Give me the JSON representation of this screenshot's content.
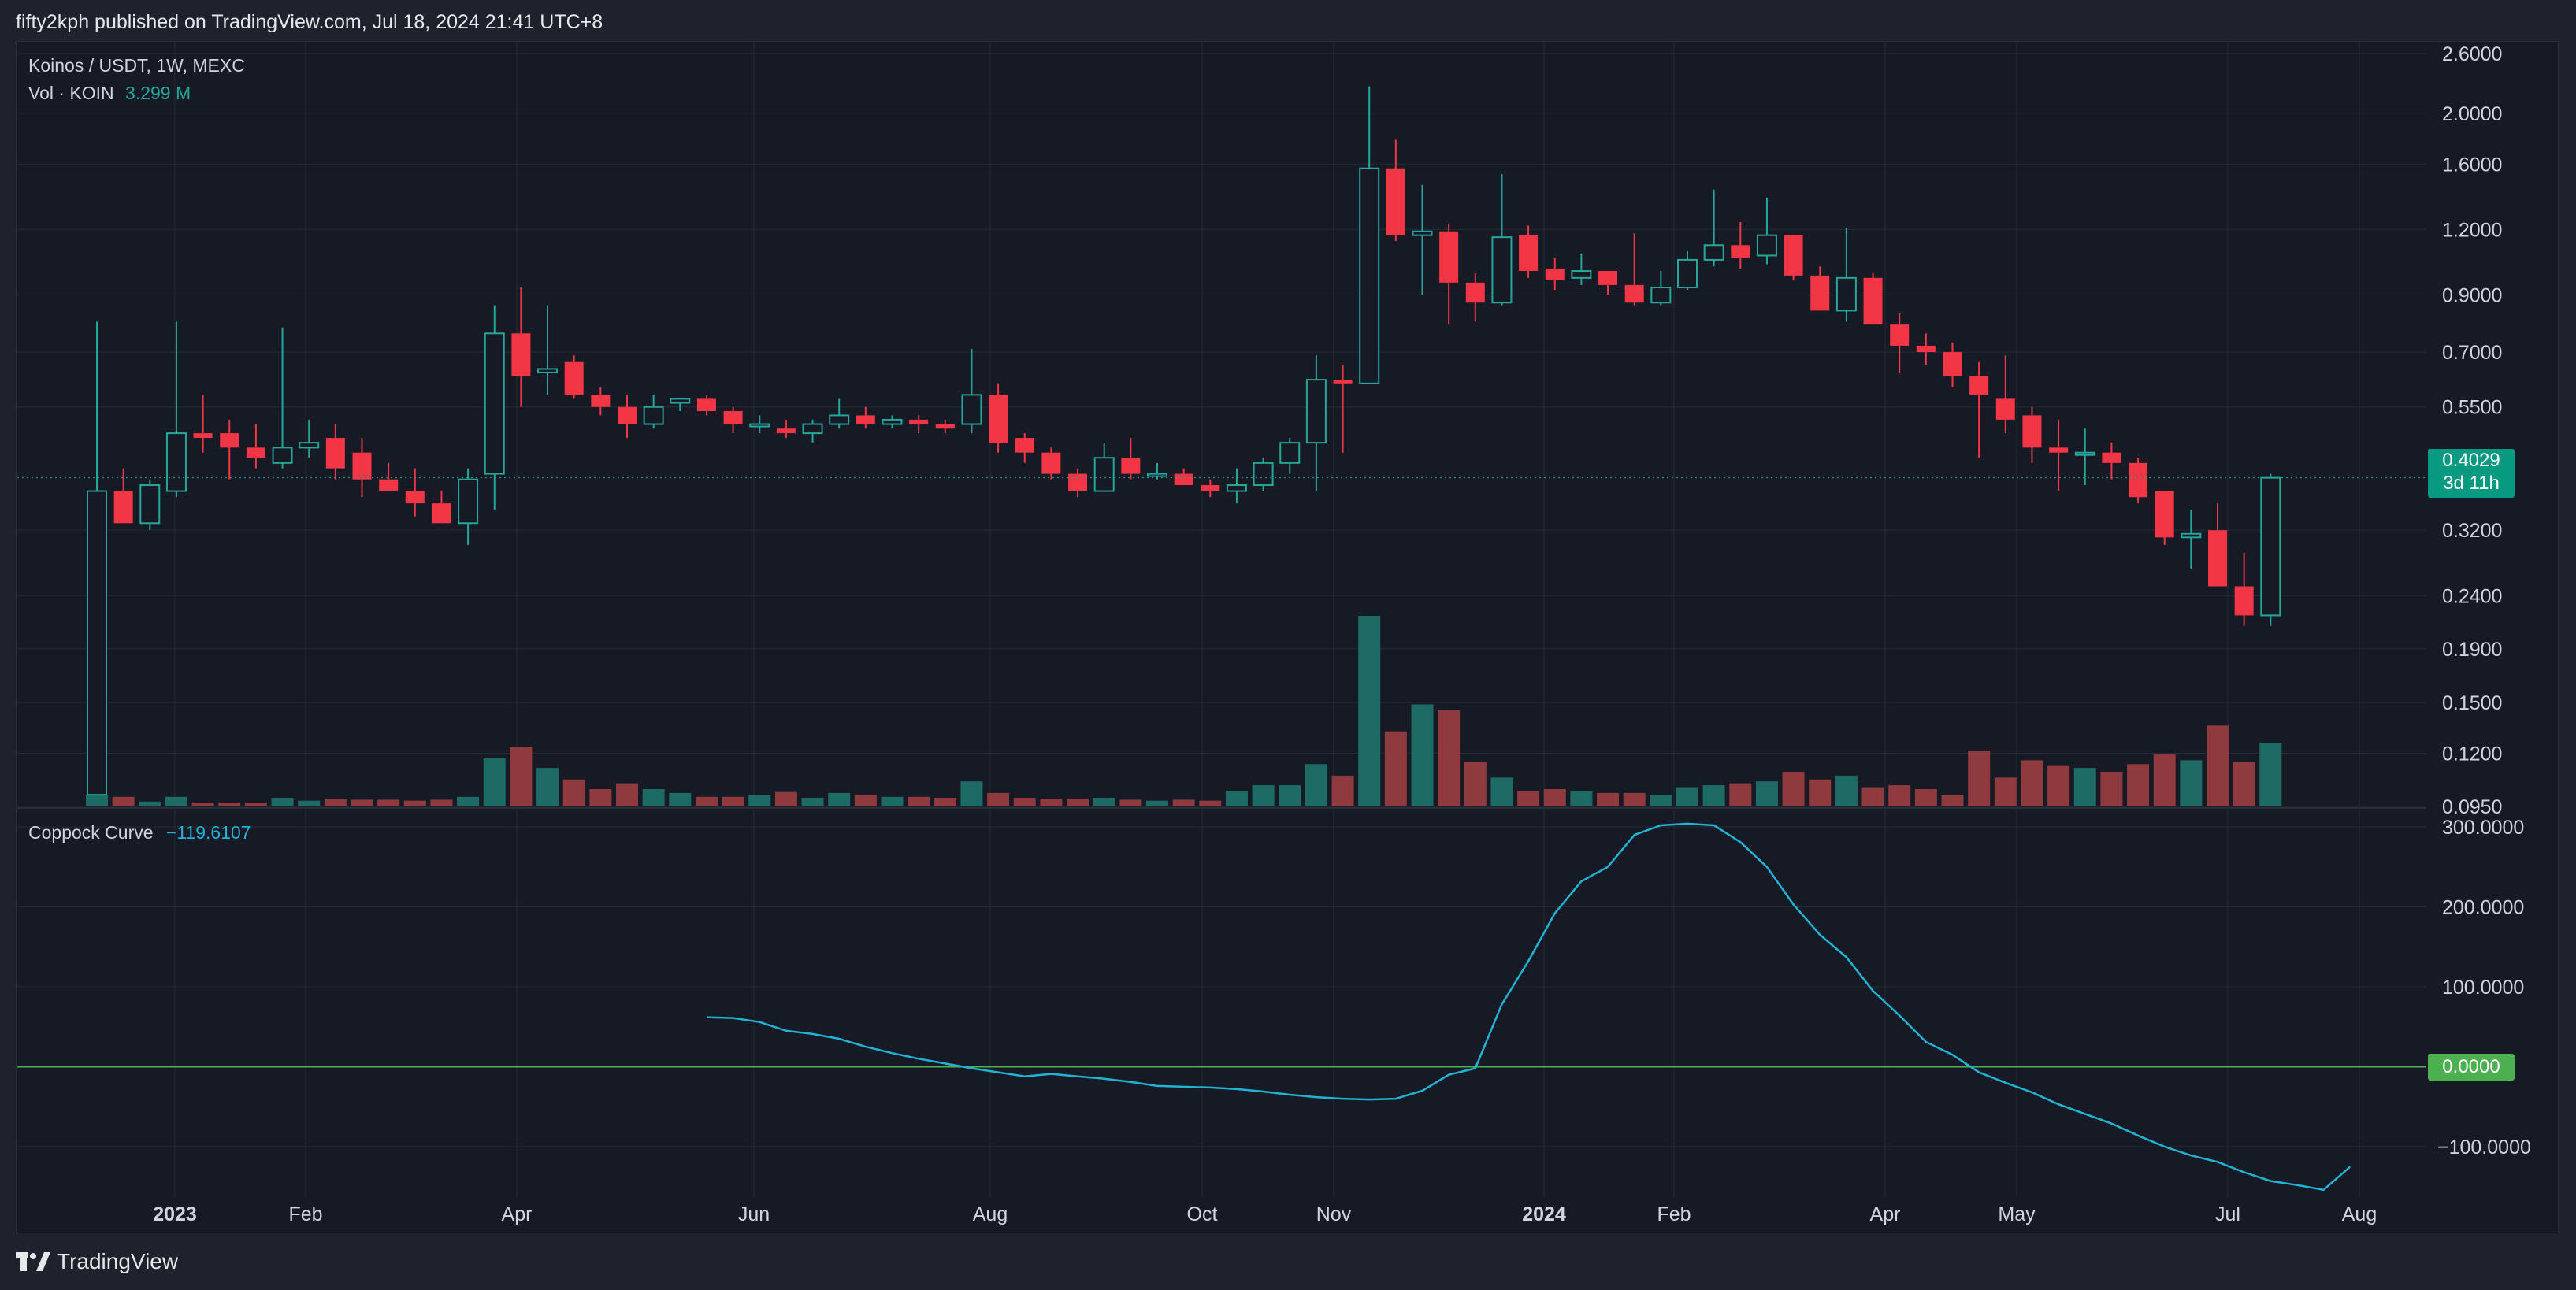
{
  "header": {
    "published_text": "fifty2kph published on TradingView.com, Jul 18, 2024 21:41 UTC+8"
  },
  "brand": {
    "name": "TradingView"
  },
  "legend": {
    "symbol": "Koinos / USDT, 1W, MEXC",
    "vol_label": "Vol · KOIN",
    "vol_value": "3.299 M",
    "indicator_label": "Coppock Curve",
    "indicator_value": "−119.6107"
  },
  "last_price": {
    "price": "0.4029",
    "countdown": "3d 11h"
  },
  "zero_label": "0.0000",
  "colors": {
    "up": "#26a69a",
    "down": "#f23645",
    "vol_up": "#1e6b66",
    "vol_down": "#8e3a3f",
    "coppock": "#22b3d4",
    "zero_line": "#4caf50",
    "background": "#161a25",
    "grid": "#262a35"
  },
  "chart_data": [
    {
      "type": "candlestick",
      "title": "Koinos / USDT, 1W, MEXC",
      "x_axis_labels": [
        "2023",
        "Feb",
        "Apr",
        "Jun",
        "Aug",
        "Oct",
        "Nov",
        "2024",
        "Feb",
        "Apr",
        "May",
        "Jul",
        "Aug"
      ],
      "y_scale": "log",
      "y_ticks": [
        "2.6000",
        "2.0000",
        "1.6000",
        "1.2000",
        "0.9000",
        "0.7000",
        "0.5500",
        "0.4029",
        "0.3200",
        "0.2400",
        "0.1900",
        "0.1500",
        "0.1200",
        "0.0950"
      ],
      "candles": [
        {
          "o": 0.1,
          "h": 0.8,
          "l": 0.1,
          "c": 0.38
        },
        {
          "o": 0.38,
          "h": 0.42,
          "l": 0.33,
          "c": 0.33
        },
        {
          "o": 0.33,
          "h": 0.4,
          "l": 0.32,
          "c": 0.39
        },
        {
          "o": 0.38,
          "h": 0.8,
          "l": 0.37,
          "c": 0.49
        },
        {
          "o": 0.49,
          "h": 0.58,
          "l": 0.45,
          "c": 0.48
        },
        {
          "o": 0.49,
          "h": 0.52,
          "l": 0.4,
          "c": 0.46
        },
        {
          "o": 0.46,
          "h": 0.51,
          "l": 0.42,
          "c": 0.44
        },
        {
          "o": 0.43,
          "h": 0.78,
          "l": 0.42,
          "c": 0.46
        },
        {
          "o": 0.46,
          "h": 0.52,
          "l": 0.44,
          "c": 0.47
        },
        {
          "o": 0.48,
          "h": 0.51,
          "l": 0.4,
          "c": 0.42
        },
        {
          "o": 0.45,
          "h": 0.48,
          "l": 0.37,
          "c": 0.4
        },
        {
          "o": 0.4,
          "h": 0.43,
          "l": 0.38,
          "c": 0.38
        },
        {
          "o": 0.38,
          "h": 0.42,
          "l": 0.34,
          "c": 0.36
        },
        {
          "o": 0.36,
          "h": 0.38,
          "l": 0.33,
          "c": 0.33
        },
        {
          "o": 0.33,
          "h": 0.42,
          "l": 0.3,
          "c": 0.4
        },
        {
          "o": 0.41,
          "h": 0.86,
          "l": 0.35,
          "c": 0.76
        },
        {
          "o": 0.76,
          "h": 0.93,
          "l": 0.55,
          "c": 0.63
        },
        {
          "o": 0.64,
          "h": 0.86,
          "l": 0.58,
          "c": 0.65
        },
        {
          "o": 0.67,
          "h": 0.69,
          "l": 0.57,
          "c": 0.58
        },
        {
          "o": 0.58,
          "h": 0.6,
          "l": 0.53,
          "c": 0.55
        },
        {
          "o": 0.55,
          "h": 0.58,
          "l": 0.48,
          "c": 0.51
        },
        {
          "o": 0.51,
          "h": 0.58,
          "l": 0.5,
          "c": 0.55
        },
        {
          "o": 0.56,
          "h": 0.57,
          "l": 0.54,
          "c": 0.57
        },
        {
          "o": 0.57,
          "h": 0.58,
          "l": 0.53,
          "c": 0.54
        },
        {
          "o": 0.54,
          "h": 0.55,
          "l": 0.49,
          "c": 0.51
        },
        {
          "o": 0.51,
          "h": 0.53,
          "l": 0.49,
          "c": 0.51
        },
        {
          "o": 0.5,
          "h": 0.52,
          "l": 0.48,
          "c": 0.49
        },
        {
          "o": 0.49,
          "h": 0.52,
          "l": 0.47,
          "c": 0.51
        },
        {
          "o": 0.51,
          "h": 0.57,
          "l": 0.5,
          "c": 0.53
        },
        {
          "o": 0.53,
          "h": 0.55,
          "l": 0.5,
          "c": 0.51
        },
        {
          "o": 0.51,
          "h": 0.53,
          "l": 0.5,
          "c": 0.52
        },
        {
          "o": 0.52,
          "h": 0.53,
          "l": 0.49,
          "c": 0.51
        },
        {
          "o": 0.51,
          "h": 0.52,
          "l": 0.49,
          "c": 0.5
        },
        {
          "o": 0.51,
          "h": 0.71,
          "l": 0.49,
          "c": 0.58
        },
        {
          "o": 0.58,
          "h": 0.61,
          "l": 0.45,
          "c": 0.47
        },
        {
          "o": 0.48,
          "h": 0.49,
          "l": 0.43,
          "c": 0.45
        },
        {
          "o": 0.45,
          "h": 0.46,
          "l": 0.4,
          "c": 0.41
        },
        {
          "o": 0.41,
          "h": 0.42,
          "l": 0.37,
          "c": 0.38
        },
        {
          "o": 0.38,
          "h": 0.47,
          "l": 0.38,
          "c": 0.44
        },
        {
          "o": 0.44,
          "h": 0.48,
          "l": 0.4,
          "c": 0.41
        },
        {
          "o": 0.41,
          "h": 0.43,
          "l": 0.4,
          "c": 0.41
        },
        {
          "o": 0.41,
          "h": 0.42,
          "l": 0.39,
          "c": 0.39
        },
        {
          "o": 0.39,
          "h": 0.4,
          "l": 0.37,
          "c": 0.38
        },
        {
          "o": 0.38,
          "h": 0.42,
          "l": 0.36,
          "c": 0.39
        },
        {
          "o": 0.39,
          "h": 0.44,
          "l": 0.38,
          "c": 0.43
        },
        {
          "o": 0.43,
          "h": 0.48,
          "l": 0.41,
          "c": 0.47
        },
        {
          "o": 0.47,
          "h": 0.69,
          "l": 0.38,
          "c": 0.62
        },
        {
          "o": 0.62,
          "h": 0.66,
          "l": 0.45,
          "c": 0.61
        },
        {
          "o": 0.61,
          "h": 2.25,
          "l": 0.61,
          "c": 1.57
        },
        {
          "o": 1.57,
          "h": 1.78,
          "l": 1.14,
          "c": 1.17
        },
        {
          "o": 1.17,
          "h": 1.46,
          "l": 0.9,
          "c": 1.19
        },
        {
          "o": 1.19,
          "h": 1.23,
          "l": 0.79,
          "c": 0.95
        },
        {
          "o": 0.95,
          "h": 0.99,
          "l": 0.8,
          "c": 0.87
        },
        {
          "o": 0.87,
          "h": 1.53,
          "l": 0.86,
          "c": 1.16
        },
        {
          "o": 1.17,
          "h": 1.22,
          "l": 0.97,
          "c": 1.0
        },
        {
          "o": 1.01,
          "h": 1.06,
          "l": 0.92,
          "c": 0.96
        },
        {
          "o": 0.97,
          "h": 1.08,
          "l": 0.94,
          "c": 1.0
        },
        {
          "o": 1.0,
          "h": 1.0,
          "l": 0.9,
          "c": 0.94
        },
        {
          "o": 0.94,
          "h": 1.18,
          "l": 0.86,
          "c": 0.87
        },
        {
          "o": 0.87,
          "h": 1.0,
          "l": 0.86,
          "c": 0.93
        },
        {
          "o": 0.93,
          "h": 1.09,
          "l": 0.92,
          "c": 1.05
        },
        {
          "o": 1.05,
          "h": 1.43,
          "l": 1.02,
          "c": 1.12
        },
        {
          "o": 1.12,
          "h": 1.24,
          "l": 1.01,
          "c": 1.06
        },
        {
          "o": 1.07,
          "h": 1.38,
          "l": 1.03,
          "c": 1.17
        },
        {
          "o": 1.17,
          "h": 1.17,
          "l": 0.96,
          "c": 0.98
        },
        {
          "o": 0.98,
          "h": 1.02,
          "l": 0.84,
          "c": 0.84
        },
        {
          "o": 0.84,
          "h": 1.21,
          "l": 0.8,
          "c": 0.97
        },
        {
          "o": 0.97,
          "h": 0.99,
          "l": 0.79,
          "c": 0.79
        },
        {
          "o": 0.79,
          "h": 0.83,
          "l": 0.64,
          "c": 0.72
        },
        {
          "o": 0.72,
          "h": 0.76,
          "l": 0.66,
          "c": 0.7
        },
        {
          "o": 0.7,
          "h": 0.73,
          "l": 0.6,
          "c": 0.63
        },
        {
          "o": 0.63,
          "h": 0.67,
          "l": 0.44,
          "c": 0.58
        },
        {
          "o": 0.57,
          "h": 0.69,
          "l": 0.49,
          "c": 0.52
        },
        {
          "o": 0.53,
          "h": 0.55,
          "l": 0.43,
          "c": 0.46
        },
        {
          "o": 0.46,
          "h": 0.52,
          "l": 0.38,
          "c": 0.45
        },
        {
          "o": 0.45,
          "h": 0.5,
          "l": 0.39,
          "c": 0.45
        },
        {
          "o": 0.45,
          "h": 0.47,
          "l": 0.4,
          "c": 0.43
        },
        {
          "o": 0.43,
          "h": 0.44,
          "l": 0.36,
          "c": 0.37
        },
        {
          "o": 0.38,
          "h": 0.38,
          "l": 0.3,
          "c": 0.31
        },
        {
          "o": 0.31,
          "h": 0.35,
          "l": 0.27,
          "c": 0.315
        },
        {
          "o": 0.32,
          "h": 0.36,
          "l": 0.25,
          "c": 0.25
        },
        {
          "o": 0.25,
          "h": 0.29,
          "l": 0.21,
          "c": 0.22
        },
        {
          "o": 0.22,
          "h": 0.41,
          "l": 0.21,
          "c": 0.4029
        }
      ],
      "volume": {
        "label": "Vol · KOIN",
        "last": "3.299 M",
        "values": [
          0.6,
          0.5,
          0.25,
          0.5,
          0.2,
          0.2,
          0.2,
          0.45,
          0.3,
          0.4,
          0.35,
          0.35,
          0.3,
          0.35,
          0.5,
          2.5,
          3.1,
          2.0,
          1.4,
          0.9,
          1.2,
          0.9,
          0.7,
          0.5,
          0.5,
          0.6,
          0.75,
          0.45,
          0.7,
          0.6,
          0.5,
          0.5,
          0.45,
          1.3,
          0.7,
          0.45,
          0.4,
          0.4,
          0.45,
          0.35,
          0.3,
          0.35,
          0.3,
          0.8,
          1.1,
          1.1,
          2.2,
          1.6,
          9.9,
          3.9,
          5.3,
          5.0,
          2.3,
          1.5,
          0.8,
          0.9,
          0.8,
          0.7,
          0.7,
          0.6,
          1.0,
          1.1,
          1.2,
          1.3,
          1.8,
          1.4,
          1.6,
          1.0,
          1.1,
          0.9,
          0.6,
          2.9,
          1.5,
          2.4,
          2.1,
          2.0,
          1.8,
          2.2,
          2.7,
          2.4,
          4.2,
          2.3,
          3.299
        ]
      }
    },
    {
      "type": "line",
      "title": "Coppock Curve",
      "last_value": -119.6107,
      "y_ticks": [
        300,
        200,
        100,
        0,
        -100
      ],
      "x_start_index": 23,
      "series": [
        {
          "name": "Coppock Curve",
          "values": [
            62,
            61,
            56,
            45,
            41,
            35,
            25,
            17,
            10,
            4,
            -2,
            -7,
            -12,
            -9,
            -12,
            -15,
            -19,
            -24,
            -25,
            -26,
            -28,
            -31,
            -35,
            -38,
            -40,
            -41,
            -40,
            -30,
            -10,
            -2,
            78,
            132,
            192,
            232,
            250,
            290,
            302,
            304,
            302,
            281,
            250,
            203,
            165,
            137,
            95,
            64,
            31,
            15,
            -7,
            -20,
            -32,
            -47,
            -59,
            -71,
            -86,
            -100,
            -111,
            -119,
            -132,
            -143,
            -148,
            -154,
            -125
          ]
        }
      ]
    }
  ]
}
